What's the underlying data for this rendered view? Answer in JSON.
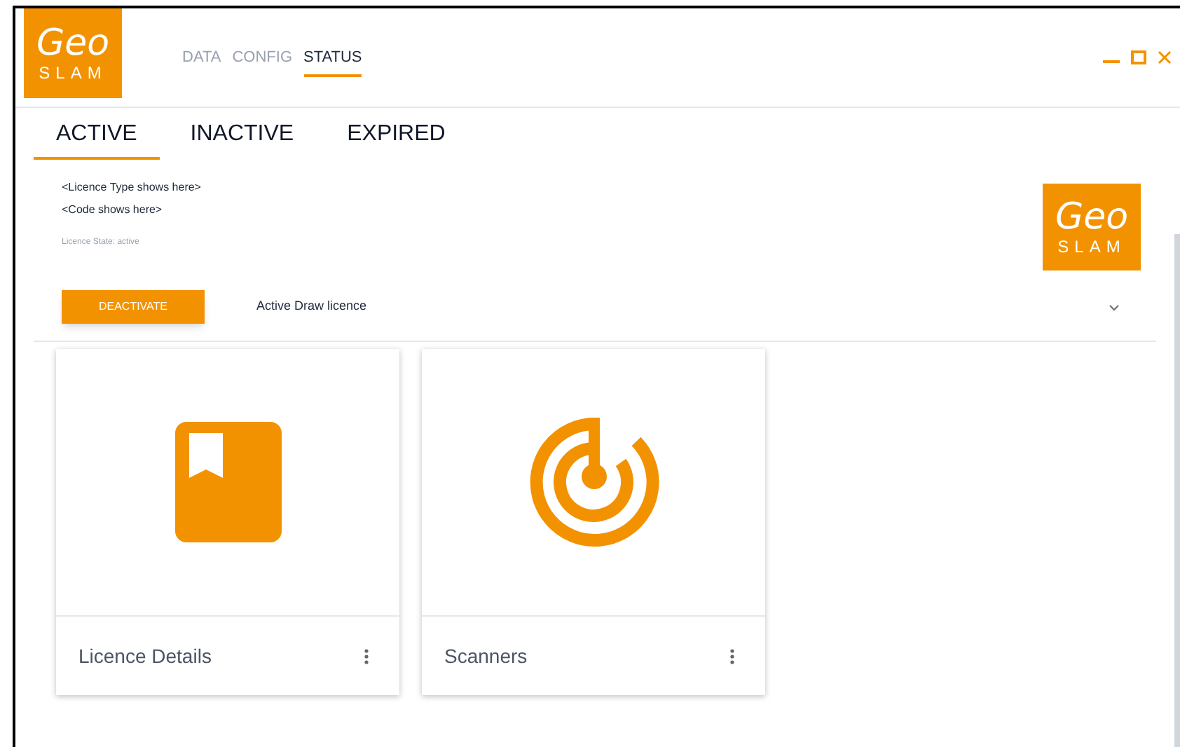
{
  "logo": {
    "top": "Geo",
    "bottom": "SLAM"
  },
  "nav": [
    {
      "label": "DATA",
      "selected": false
    },
    {
      "label": "CONFIG",
      "selected": false
    },
    {
      "label": "STATUS",
      "selected": true
    }
  ],
  "tabs": [
    {
      "label": "ACTIVE",
      "selected": true
    },
    {
      "label": "INACTIVE",
      "selected": false
    },
    {
      "label": "EXPIRED",
      "selected": false
    }
  ],
  "licence": {
    "type": "<Licence Type shows here>",
    "code": "<Code shows here>",
    "state": "Licence State: active"
  },
  "badge_logo": {
    "top": "Geo",
    "bottom": "SLAM"
  },
  "action": {
    "button": "DEACTIVATE",
    "select_value": "Active Draw licence"
  },
  "cards": [
    {
      "kind": "book",
      "title": "Licence Details"
    },
    {
      "kind": "radar",
      "title": "Scanners"
    }
  ]
}
